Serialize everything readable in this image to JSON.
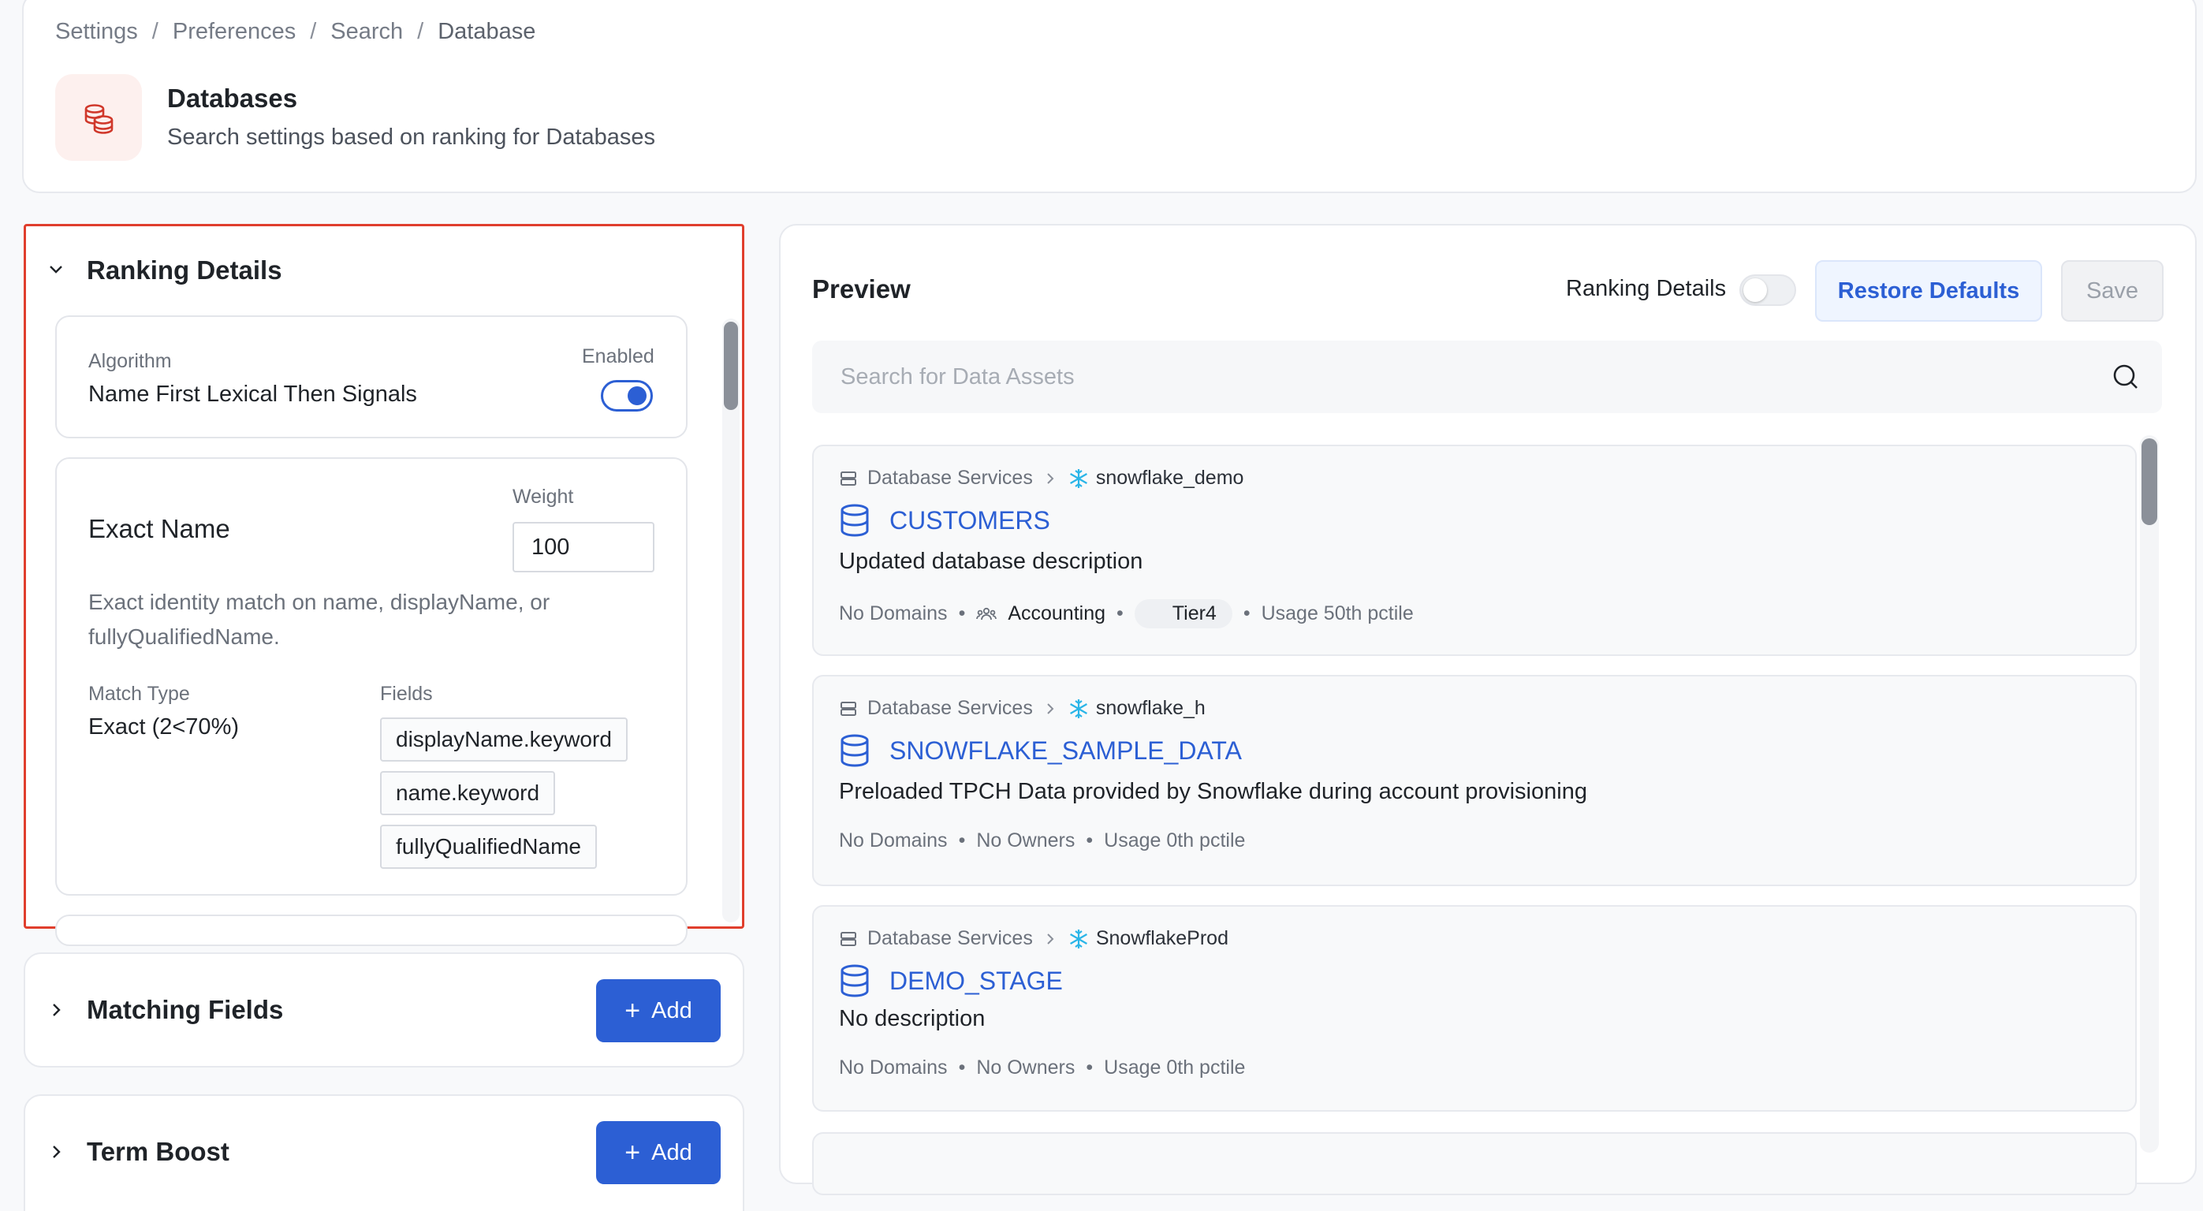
{
  "breadcrumb": [
    "Settings",
    "Preferences",
    "Search",
    "Database"
  ],
  "header": {
    "title": "Databases",
    "subtitle": "Search settings based on ranking for Databases"
  },
  "ranking": {
    "title": "Ranking Details",
    "algorithm_label": "Algorithm",
    "algorithm_value": "Name First Lexical Then Signals",
    "enabled_label": "Enabled",
    "enabled": true,
    "exact": {
      "title": "Exact Name",
      "weight_label": "Weight",
      "weight_value": "100",
      "description": "Exact identity match on name, displayName, or fullyQualifiedName.",
      "match_type_label": "Match Type",
      "match_type_value": "Exact (2<70%)",
      "fields_label": "Fields",
      "fields": [
        "displayName.keyword",
        "name.keyword",
        "fullyQualifiedName"
      ]
    }
  },
  "sections": {
    "matching_title": "Matching Fields",
    "term_title": "Term Boost",
    "add_label": "Add"
  },
  "preview": {
    "title": "Preview",
    "ranking_label": "Ranking Details",
    "ranking_toggle_on": false,
    "restore_label": "Restore Defaults",
    "save_label": "Save",
    "search_placeholder": "Search for Data Assets",
    "results": [
      {
        "category": "Database Services",
        "service": "snowflake_demo",
        "name": "CUSTOMERS",
        "description": "Updated database description",
        "domains": "No Domains",
        "owner": "Accounting",
        "tier": "Tier4",
        "usage": "Usage 50th pctile"
      },
      {
        "category": "Database Services",
        "service": "snowflake_h",
        "name": "SNOWFLAKE_SAMPLE_DATA",
        "description": "Preloaded TPCH Data provided by Snowflake during account provisioning",
        "domains": "No Domains",
        "owner": "No Owners",
        "usage": "Usage 0th pctile"
      },
      {
        "category": "Database Services",
        "service": "SnowflakeProd",
        "name": "DEMO_STAGE",
        "description": "No description",
        "domains": "No Domains",
        "owner": "No Owners",
        "usage": "Usage 0th pctile"
      }
    ]
  },
  "colors": {
    "accent": "#2c5fd4",
    "highlight_border": "#e03e2d",
    "snowflake": "#29b5e8"
  }
}
